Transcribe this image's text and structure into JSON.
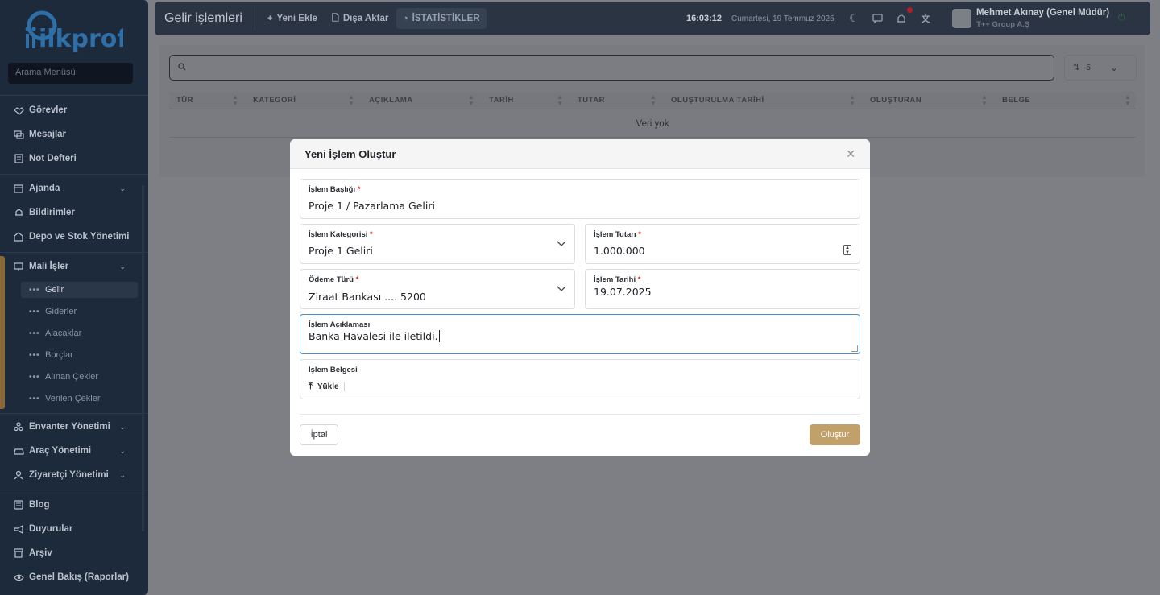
{
  "sidebar": {
    "logo_text": "ilkprof",
    "search_placeholder": "Arama Menüsü",
    "items": [
      {
        "label": "Görevler",
        "icon": "handshake-icon"
      },
      {
        "label": "Mesajlar",
        "icon": "messages-icon"
      },
      {
        "label": "Not Defteri",
        "icon": "notebook-icon"
      },
      {
        "label": "Ajanda",
        "icon": "calendar-icon"
      },
      {
        "label": "Bildirimler",
        "icon": "bell-icon"
      },
      {
        "label": "Depo ve Stok Yönetimi",
        "icon": "warehouse-icon"
      },
      {
        "label": "Mali İşler",
        "icon": "finance-icon"
      },
      {
        "label": "Envanter Yönetimi",
        "icon": "inventory-icon"
      },
      {
        "label": "Araç Yönetimi",
        "icon": "car-icon"
      },
      {
        "label": "Ziyaretçi Yönetimi",
        "icon": "visitor-icon"
      },
      {
        "label": "Blog",
        "icon": "blog-icon"
      },
      {
        "label": "Duyurular",
        "icon": "megaphone-icon"
      },
      {
        "label": "Arşiv",
        "icon": "archive-icon"
      },
      {
        "label": "Genel Bakış (Raporlar)",
        "icon": "report-icon"
      }
    ],
    "sub_items": [
      "Gelir",
      "Giderler",
      "Alacaklar",
      "Borçlar",
      "Alınan Çekler",
      "Verilen Çekler"
    ],
    "active_sub": "Gelir"
  },
  "topbar": {
    "title": "Gelir işlemleri",
    "new_label": "Yeni Ekle",
    "export_label": "Dışa Aktar",
    "stats_label": "İSTATİSTİKLER",
    "time": "16:03:12",
    "date": "Cumartesi, 19 Temmuz 2025",
    "user_name": "Mehmet Akınay (Genel Müdür)",
    "company": "T++ Group A.Ş"
  },
  "table": {
    "page_size": "5",
    "columns": [
      "TÜR",
      "KATEGORİ",
      "AÇIKLAMA",
      "TARİH",
      "TUTAR",
      "OLUŞTURULMA TARİHİ",
      "OLUŞTURAN",
      "BELGE"
    ],
    "empty_text": "Veri yok"
  },
  "modal": {
    "title": "Yeni İşlem Oluştur",
    "title_field": {
      "label": "İşlem Başlığı",
      "value": "Proje 1 / Pazarlama Geliri"
    },
    "category": {
      "label": "İşlem Kategorisi",
      "value": "Proje 1 Geliri"
    },
    "amount": {
      "label": "İşlem Tutarı",
      "value": "1.000.000"
    },
    "payment": {
      "label": "Ödeme Türü",
      "value": "Ziraat Bankası .... 5200"
    },
    "date": {
      "label": "İşlem Tarihi",
      "value": "19.07.2025"
    },
    "description": {
      "label": "İşlem Açıklaması",
      "value": "Banka Havalesi ile iletildi."
    },
    "document": {
      "label": "İşlem Belgesi",
      "upload_label": "Yükle"
    },
    "required_mark": "*",
    "cancel_label": "İptal",
    "create_label": "Oluştur"
  },
  "colors": {
    "sidebar_bg": "#1d2a3c",
    "accent": "#c2a06a",
    "focus": "#4a8ec9",
    "required": "#d02f2f"
  }
}
